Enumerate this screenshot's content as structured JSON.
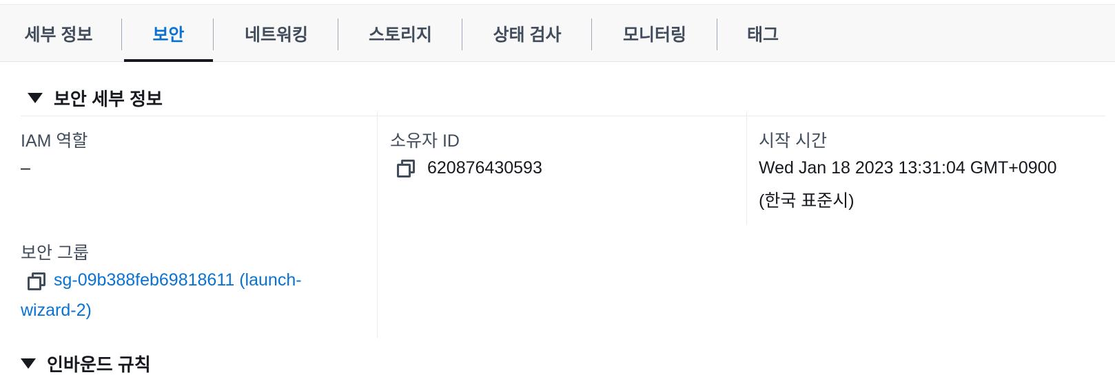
{
  "tabs": [
    {
      "label": "세부 정보",
      "active": false
    },
    {
      "label": "보안",
      "active": true
    },
    {
      "label": "네트워킹",
      "active": false
    },
    {
      "label": "스토리지",
      "active": false
    },
    {
      "label": "상태 검사",
      "active": false
    },
    {
      "label": "모니터링",
      "active": false
    },
    {
      "label": "태그",
      "active": false
    }
  ],
  "security_details": {
    "header": "보안 세부 정보",
    "iam_role": {
      "label": "IAM 역할",
      "value": "–"
    },
    "owner_id": {
      "label": "소유자 ID",
      "value": "620876430593"
    },
    "launch_time": {
      "label": "시작 시간",
      "value_line1": "Wed Jan 18 2023 13:31:04 GMT+0900",
      "value_line2": "(한국 표준시)"
    },
    "security_groups": {
      "label": "보안 그룹",
      "link_line1": "sg-09b388feb69818611 (launch-",
      "link_line2": "wizard-2)"
    }
  },
  "inbound_rules": {
    "header": "인바운드 규칙"
  },
  "colors": {
    "accent": "#0972d3",
    "text": "#16191f",
    "label": "#414d5c"
  }
}
